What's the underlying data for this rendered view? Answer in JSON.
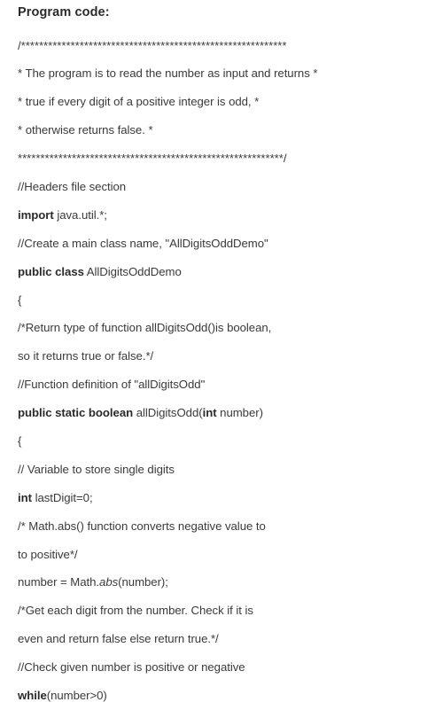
{
  "document": {
    "heading": "Program code:",
    "language": "java",
    "text_color": "#3a3a3a",
    "background_color": "#ffffff",
    "lines": [
      {
        "id": "comment-banner-open",
        "segments": [
          {
            "text": "/",
            "style": "normal"
          },
          {
            "text": "***********************************************************",
            "style": "normal"
          }
        ]
      },
      {
        "id": "comment-desc-1",
        "segments": [
          {
            "text": "* The program is to read the number as input and returns *",
            "style": "normal"
          }
        ]
      },
      {
        "id": "comment-desc-2",
        "segments": [
          {
            "text": "* true if every digit of a positive integer is odd, *",
            "style": "normal"
          }
        ]
      },
      {
        "id": "comment-desc-3",
        "segments": [
          {
            "text": "* otherwise returns false. *",
            "style": "normal"
          }
        ]
      },
      {
        "id": "comment-banner-close",
        "segments": [
          {
            "text": "***********************************************************",
            "style": "normal"
          },
          {
            "text": "/",
            "style": "normal"
          }
        ]
      },
      {
        "id": "comment-headers",
        "segments": [
          {
            "text": "//Headers file section",
            "style": "normal"
          }
        ]
      },
      {
        "id": "import-statement",
        "segments": [
          {
            "text": "import",
            "style": "bold"
          },
          {
            "text": " java.util.*;",
            "style": "normal"
          }
        ]
      },
      {
        "id": "comment-create-class",
        "segments": [
          {
            "text": "//Create a main class name, \"AllDigitsOddDemo\"",
            "style": "normal"
          }
        ]
      },
      {
        "id": "class-declaration",
        "segments": [
          {
            "text": "public class",
            "style": "bold"
          },
          {
            "text": " AllDigitsOddDemo",
            "style": "normal"
          }
        ]
      },
      {
        "id": "class-open-brace",
        "segments": [
          {
            "text": "{",
            "style": "normal"
          }
        ]
      },
      {
        "id": "comment-return-type-1",
        "segments": [
          {
            "text": "/*Return type of function allDigitsOdd()is boolean,",
            "style": "normal"
          }
        ]
      },
      {
        "id": "comment-return-type-2",
        "segments": [
          {
            "text": "so it returns true or false.*/",
            "style": "normal"
          }
        ]
      },
      {
        "id": "comment-function-definition",
        "segments": [
          {
            "text": "//Function definition of \"allDigitsOdd\"",
            "style": "normal"
          }
        ]
      },
      {
        "id": "method-signature",
        "segments": [
          {
            "text": "public static boolean",
            "style": "bold"
          },
          {
            "text": " allDigitsOdd(",
            "style": "normal"
          },
          {
            "text": "int",
            "style": "bold"
          },
          {
            "text": " number)",
            "style": "normal"
          }
        ]
      },
      {
        "id": "method-open-brace",
        "segments": [
          {
            "text": "{",
            "style": "normal"
          }
        ]
      },
      {
        "id": "comment-variable",
        "segments": [
          {
            "text": "// Variable to store single digits",
            "style": "normal"
          }
        ]
      },
      {
        "id": "declare-lastdigit",
        "segments": [
          {
            "text": "int",
            "style": "bold"
          },
          {
            "text": " lastDigit=0;",
            "style": "normal"
          }
        ]
      },
      {
        "id": "comment-mathabs-1",
        "segments": [
          {
            "text": "/* Math.abs() function converts negative value to",
            "style": "normal"
          }
        ]
      },
      {
        "id": "comment-mathabs-2",
        "segments": [
          {
            "text": "to positive*/",
            "style": "normal"
          }
        ]
      },
      {
        "id": "assign-number-abs",
        "segments": [
          {
            "text": "number = Math.",
            "style": "normal"
          },
          {
            "text": "abs",
            "style": "italic"
          },
          {
            "text": "(number);",
            "style": "normal"
          }
        ]
      },
      {
        "id": "comment-get-digit-1",
        "segments": [
          {
            "text": "/*Get each digit from the number. Check if it is",
            "style": "normal"
          }
        ]
      },
      {
        "id": "comment-get-digit-2",
        "segments": [
          {
            "text": "even and return false else return true.*/",
            "style": "normal"
          }
        ]
      },
      {
        "id": "comment-check-sign",
        "segments": [
          {
            "text": "//Check given number is positive or negative",
            "style": "normal"
          }
        ]
      },
      {
        "id": "while-statement",
        "segments": [
          {
            "text": "while",
            "style": "bold"
          },
          {
            "text": "(number>0)",
            "style": "normal"
          }
        ]
      }
    ]
  }
}
